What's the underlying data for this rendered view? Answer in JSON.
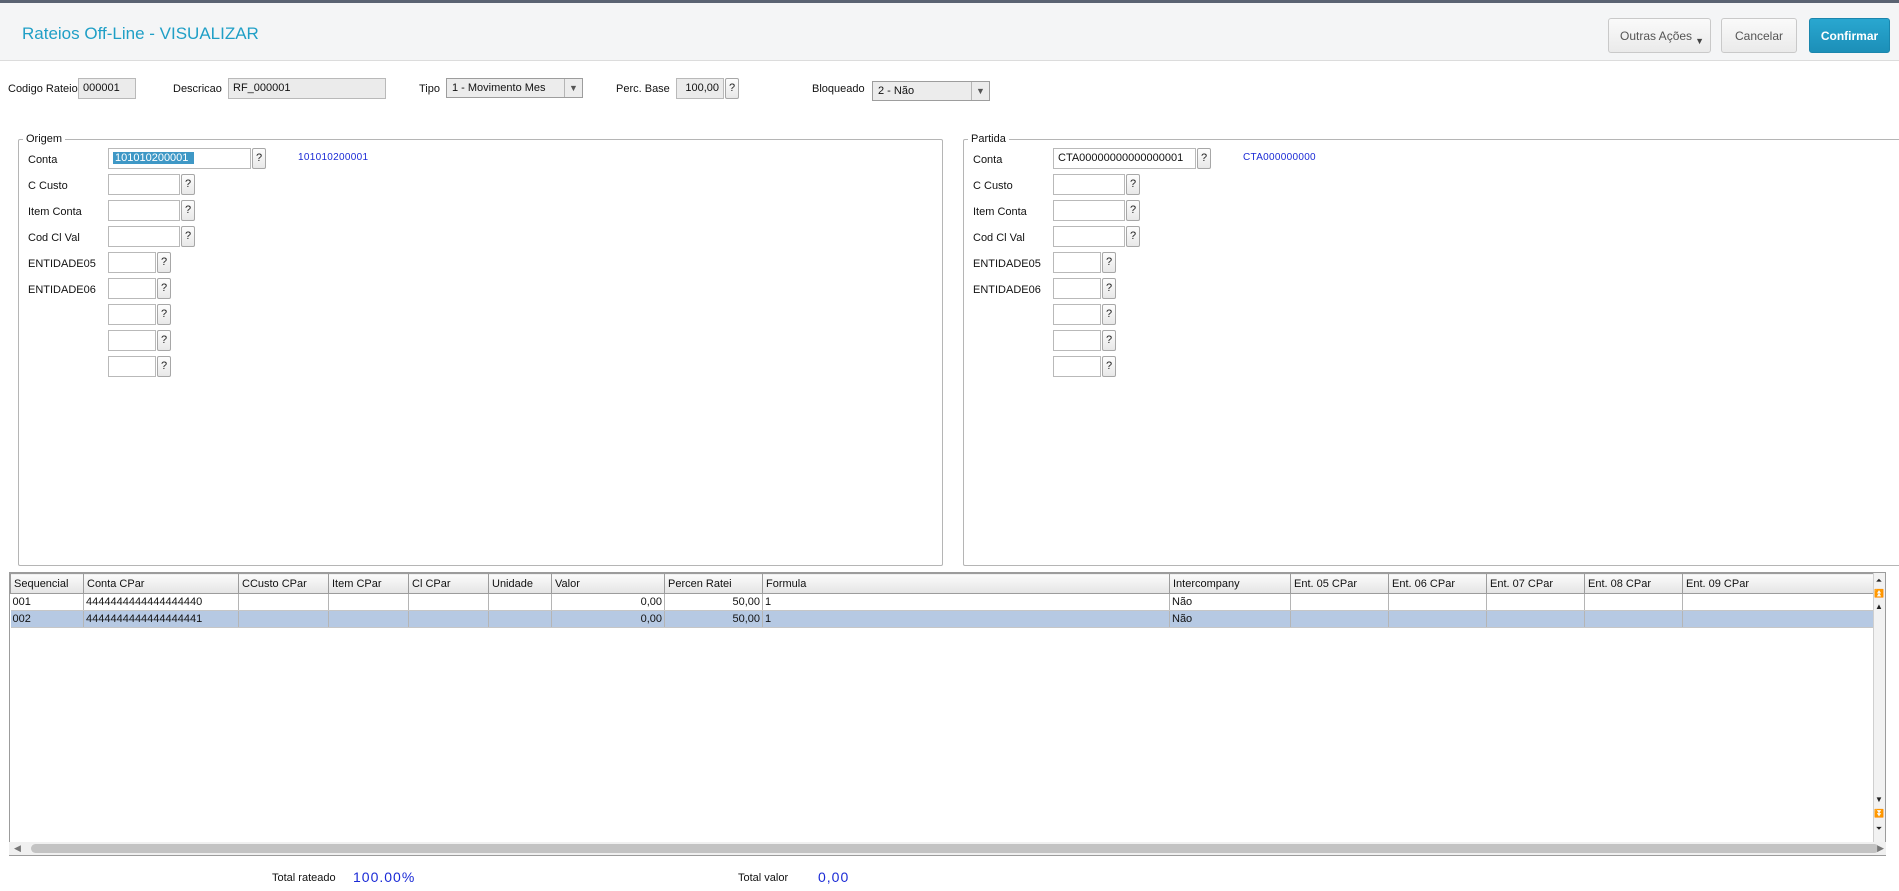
{
  "header": {
    "title": "Rateios Off-Line - VISUALIZAR",
    "outras_acoes": "Outras Ações",
    "cancelar": "Cancelar",
    "confirmar": "Confirmar"
  },
  "form": {
    "codigo_label": "Codigo Rateio",
    "codigo_value": "000001",
    "descricao_label": "Descricao",
    "descricao_value": "RF_000001",
    "tipo_label": "Tipo",
    "tipo_value": "1 - Movimento Mes",
    "perc_label": "Perc. Base",
    "perc_value": "100,00",
    "bloqueado_label": "Bloqueado",
    "bloqueado_value": "2 - Não"
  },
  "origem": {
    "legend": "Origem",
    "conta_label": "Conta",
    "conta_value": "101010200001",
    "conta_desc": "101010200001",
    "ccusto_label": "C Custo",
    "itemconta_label": "Item Conta",
    "codclval_label": "Cod Cl Val",
    "ent05_label": "ENTIDADE05",
    "ent06_label": "ENTIDADE06"
  },
  "partida": {
    "legend": "Partida",
    "conta_label": "Conta",
    "conta_value": "CTA00000000000000001",
    "conta_desc": "CTA000000000",
    "ccusto_label": "C Custo",
    "itemconta_label": "Item Conta",
    "codclval_label": "Cod Cl Val",
    "ent05_label": "ENTIDADE05",
    "ent06_label": "ENTIDADE06"
  },
  "help_glyph": "?",
  "grid": {
    "columns": [
      "Sequencial",
      "Conta CPar",
      "CCusto CPar",
      "Item CPar",
      "Cl CPar",
      "Unidade",
      "Valor",
      "Percen Ratei",
      "Formula",
      "Intercompany",
      "Ent. 05 CPar",
      "Ent. 06 CPar",
      "Ent. 07 CPar",
      "Ent. 08 CPar",
      "Ent. 09 CPar"
    ],
    "rows": [
      [
        "001",
        "4444444444444444440",
        "",
        "",
        "",
        "",
        "0,00",
        "50,00",
        "1",
        "Não",
        "",
        "",
        "",
        "",
        ""
      ],
      [
        "002",
        "4444444444444444441",
        "",
        "",
        "",
        "",
        "0,00",
        "50,00",
        "1",
        "Não",
        "",
        "",
        "",
        "",
        ""
      ]
    ]
  },
  "totals": {
    "rateado_label": "Total rateado",
    "rateado_value": "100.00%",
    "valor_label": "Total valor",
    "valor_value": "0,00"
  }
}
